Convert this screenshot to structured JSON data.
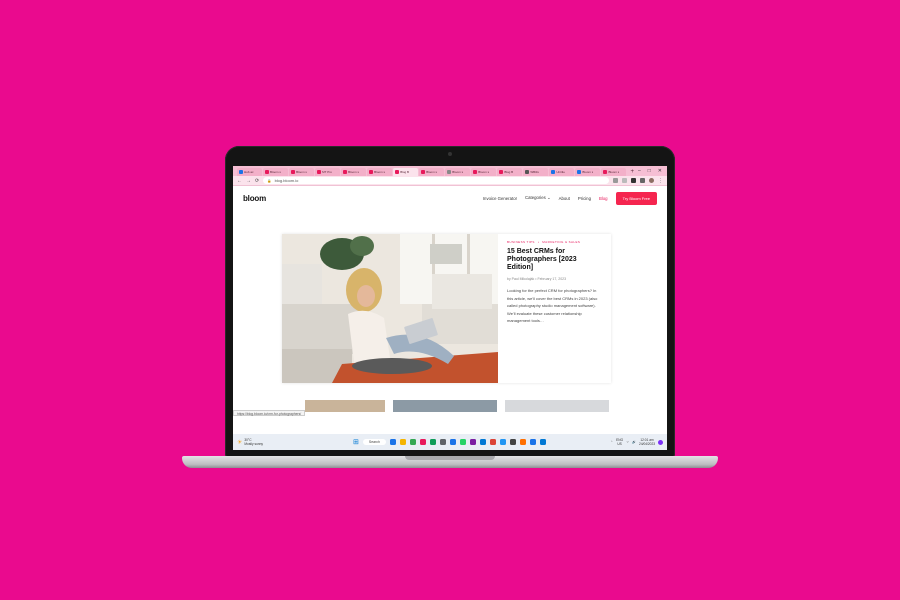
{
  "browser": {
    "tabs": [
      {
        "title": "Hub ac",
        "color": "#1a73e8"
      },
      {
        "title": "Bloom s",
        "color": "#e8195b"
      },
      {
        "title": "Bloom s",
        "color": "#e8195b"
      },
      {
        "title": "MT Pro",
        "color": "#e8195b"
      },
      {
        "title": "Bloom s",
        "color": "#e8195b"
      },
      {
        "title": "Bloom s",
        "color": "#e8195b"
      },
      {
        "title": "Blog B",
        "color": "#e8195b",
        "active": true
      },
      {
        "title": "Bloom s",
        "color": "#e8195b"
      },
      {
        "title": "Bloom s",
        "color": "#888888"
      },
      {
        "title": "Bloom s",
        "color": "#e8195b"
      },
      {
        "title": "Blog B",
        "color": "#e8195b"
      },
      {
        "title": "WBtils",
        "color": "#555555"
      },
      {
        "title": "Untitle",
        "color": "#1a73e8"
      },
      {
        "title": "Bloom s",
        "color": "#1a73e8"
      },
      {
        "title": "Bloom s",
        "color": "#e8195b"
      }
    ],
    "new_tab": "+",
    "url": "blog.bloom.io"
  },
  "site": {
    "logo": "bloom",
    "nav": {
      "invoice": "Invoice Generator",
      "categories": "Categories ⌄",
      "about": "About",
      "pricing": "Pricing",
      "blog": "Blog"
    },
    "cta": "Try Bloom Free"
  },
  "post": {
    "category_1": "Business Tips",
    "category_sep": "•",
    "category_2": "Marketing & Sales",
    "title": "15 Best CRMs for Photographers [2023 Edition]",
    "author": "by Paul Mikolaják",
    "date_sep": "•",
    "date": "February 17, 2023",
    "excerpt": "Looking for the perfect CRM for photographers? In this article, we'll cover the best CRMs in 2023 (also called photography studio management software). We'll evaluate these customer relationship management tools…"
  },
  "status_url": "https://blog.bloom.io/crm-for-photographers/",
  "taskbar": {
    "weather_temp": "30°C",
    "weather_desc": "Mostly sunny",
    "search": "Search",
    "lang_1": "ENG",
    "lang_2": "US",
    "time": "12:01 am",
    "date": "24/04/2023",
    "icons": [
      "#1a73e8",
      "#f4b400",
      "#34a853",
      "#e8195b",
      "#0f9d58",
      "#5f6368",
      "#1a73e8",
      "#25d366",
      "#7b1fa2",
      "#0078d4",
      "#db4437",
      "#2196f3",
      "#444444",
      "#ff6f00",
      "#1a73e8",
      "#0078d4"
    ]
  }
}
